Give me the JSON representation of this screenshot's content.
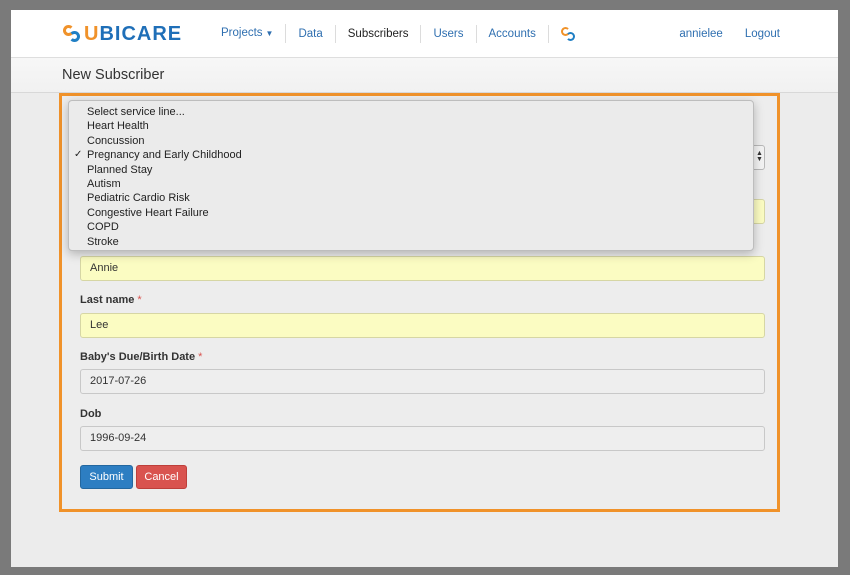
{
  "brand": {
    "logo_text_u": "U",
    "logo_text_rest": "BICARE"
  },
  "nav": {
    "items": [
      {
        "label": "Projects"
      },
      {
        "label": "Data"
      },
      {
        "label": "Subscribers"
      },
      {
        "label": "Users"
      },
      {
        "label": "Accounts"
      }
    ],
    "user": "annielee",
    "logout": "Logout"
  },
  "page": {
    "title": "New Subscriber"
  },
  "form": {
    "first_name_value": "Annie",
    "last_name_label": "Last name",
    "last_name_value": "Lee",
    "due_date_label": "Baby's Due/Birth Date",
    "due_date_value": "2017-07-26",
    "dob_label": "Dob",
    "dob_value": "1996-09-24",
    "required_mark": "*",
    "submit_label": "Submit",
    "cancel_label": "Cancel"
  },
  "service_line": {
    "options": [
      "Select service line...",
      "Heart Health",
      "Concussion",
      "Pregnancy and Early Childhood",
      "Planned Stay",
      "Autism",
      "Pediatric Cardio Risk",
      "Congestive Heart Failure",
      "COPD",
      "Stroke"
    ],
    "selected": "Pregnancy and Early Childhood",
    "check_glyph": "✓"
  },
  "colors": {
    "highlight": "#f0922a",
    "brand_blue": "#1f6fb8",
    "submit": "#2d7ec2",
    "cancel": "#d9534f",
    "autofill": "#fbfcc2"
  }
}
